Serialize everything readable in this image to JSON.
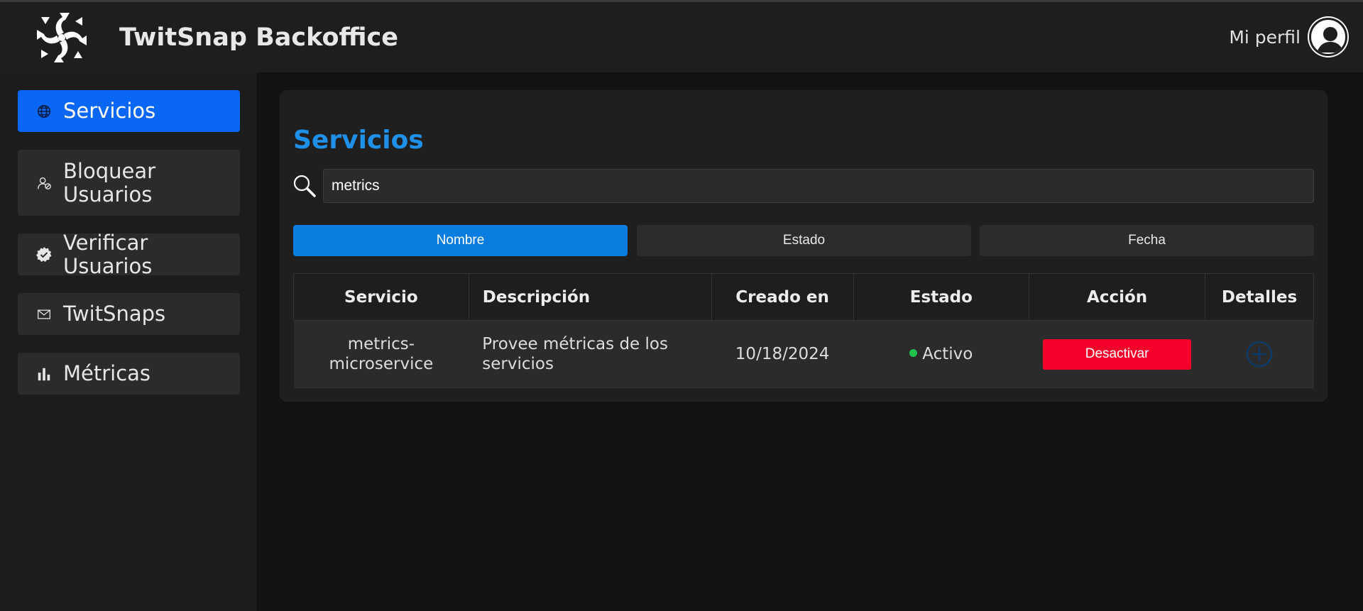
{
  "app": {
    "title": "TwitSnap Backoffice"
  },
  "header": {
    "profile_label": "Mi perfil"
  },
  "sidebar": {
    "items": [
      {
        "label": "Servicios",
        "icon": "globe-icon",
        "active": true
      },
      {
        "label": "Bloquear Usuarios",
        "icon": "user-block-icon",
        "active": false
      },
      {
        "label": "Verificar Usuarios",
        "icon": "verified-badge-icon",
        "active": false
      },
      {
        "label": "TwitSnaps",
        "icon": "envelope-icon",
        "active": false
      },
      {
        "label": "Métricas",
        "icon": "bar-chart-icon",
        "active": false
      }
    ]
  },
  "main": {
    "title": "Servicios",
    "search": {
      "value": "metrics",
      "icon": "search-icon"
    },
    "sort_buttons": [
      {
        "label": "Nombre",
        "active": true
      },
      {
        "label": "Estado",
        "active": false
      },
      {
        "label": "Fecha",
        "active": false
      }
    ],
    "table": {
      "columns": [
        "Servicio",
        "Descripción",
        "Creado en",
        "Estado",
        "Acción",
        "Detalles"
      ],
      "rows": [
        {
          "service": "metrics-microservice",
          "description": "Provee métricas de los servicios",
          "created": "10/18/2024",
          "status": "Activo",
          "action": "Desactivar",
          "details_icon": "plus-circle-icon"
        }
      ]
    }
  },
  "colors": {
    "accent": "#0a66f5",
    "title_blue": "#1e90e8",
    "status_active": "#21c24a",
    "danger": "#f5002a"
  }
}
